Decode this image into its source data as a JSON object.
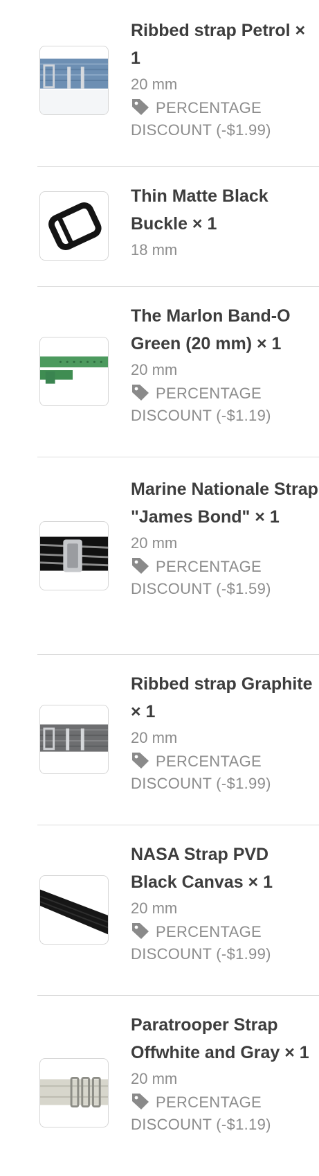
{
  "colors": {
    "title": "#3d3d3d",
    "muted": "#8c8c8c",
    "divider": "#dcdcdc",
    "tag_icon": "#8a8a8a"
  },
  "order_items": [
    {
      "name": "Ribbed strap Petrol × 1",
      "size": "20 mm",
      "discount": "PERCENTAGE DISCOUNT (-$1.99)",
      "image_icon": "petrol-ribbed-strap-image"
    },
    {
      "name": "Thin Matte Black Buckle × 1",
      "size": "18 mm",
      "image_icon": "black-buckle-image"
    },
    {
      "name": "The Marlon Band-O Green (20 mm) × 1",
      "size": "20 mm",
      "discount": "PERCENTAGE DISCOUNT (-$1.19)",
      "image_icon": "green-rubber-band-image"
    },
    {
      "name": "Marine Nationale Strap \"James Bond\" × 1",
      "size": "20 mm",
      "discount": "PERCENTAGE DISCOUNT (-$1.59)",
      "image_icon": "striped-marine-strap-image"
    },
    {
      "name": "Ribbed strap Graphite × 1",
      "size": "20 mm",
      "discount": "PERCENTAGE DISCOUNT (-$1.99)",
      "image_icon": "graphite-ribbed-strap-image"
    },
    {
      "name": "NASA Strap PVD Black Canvas × 1",
      "size": "20 mm",
      "discount": "PERCENTAGE DISCOUNT (-$1.99)",
      "image_icon": "black-canvas-strap-image"
    },
    {
      "name": "Paratrooper Strap Offwhite and Gray × 1",
      "size": "20 mm",
      "discount": "PERCENTAGE DISCOUNT (-$1.19)",
      "image_icon": "paratrooper-strap-image"
    }
  ]
}
